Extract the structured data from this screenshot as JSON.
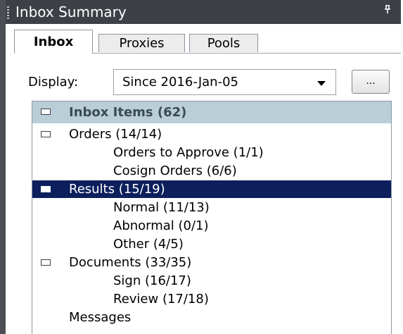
{
  "panel": {
    "title": "Inbox Summary",
    "pin_icon": "pin-icon"
  },
  "tabs": [
    {
      "label": "Inbox",
      "active": true
    },
    {
      "label": "Proxies",
      "active": false
    },
    {
      "label": "Pools",
      "active": false
    }
  ],
  "display": {
    "label": "Display:",
    "selected": "Since 2016-Jan-05",
    "more_button": "..."
  },
  "tree": {
    "header": "Inbox Items (62)",
    "items": [
      {
        "label": "Orders (14/14)"
      },
      {
        "label": "Orders to Approve (1/1)"
      },
      {
        "label": "Cosign Orders (6/6)"
      },
      {
        "label": "Results (15/19)"
      },
      {
        "label": "Normal (11/13)"
      },
      {
        "label": "Abnormal (0/1)"
      },
      {
        "label": "Other (4/5)"
      },
      {
        "label": "Documents (33/35)"
      },
      {
        "label": "Sign (16/17)"
      },
      {
        "label": "Review (17/18)"
      },
      {
        "label": "Messages"
      }
    ]
  },
  "colors": {
    "titlebar": "#3d4147",
    "header_bg": "#b9ced7",
    "selected_bg": "#0c1f5c"
  }
}
